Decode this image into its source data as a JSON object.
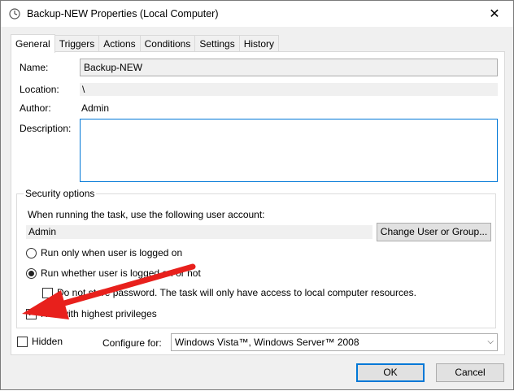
{
  "window": {
    "title": "Backup-NEW Properties (Local Computer)",
    "close_label": "✕"
  },
  "tabs": [
    {
      "label": "General",
      "active": true
    },
    {
      "label": "Triggers"
    },
    {
      "label": "Actions"
    },
    {
      "label": "Conditions"
    },
    {
      "label": "Settings"
    },
    {
      "label": "History"
    }
  ],
  "general": {
    "name_label": "Name:",
    "name_value": "Backup-NEW",
    "location_label": "Location:",
    "location_value": "\\",
    "author_label": "Author:",
    "author_value": "Admin",
    "description_label": "Description:",
    "description_value": ""
  },
  "security": {
    "group_title": "Security options",
    "account_prompt": "When running the task, use the following user account:",
    "account_value": "Admin",
    "change_user_button": "Change User or Group...",
    "radio_logged_on": "Run only when user is logged on",
    "radio_logged_on_checked": false,
    "radio_whether": "Run whether user is logged on or not",
    "radio_whether_checked": true,
    "no_store_password": "Do not store password.  The task will only have access to local computer resources.",
    "no_store_password_checked": false,
    "highest_privileges": "Run with highest privileges",
    "highest_privileges_checked": true
  },
  "bottom": {
    "hidden_label": "Hidden",
    "hidden_checked": false,
    "configure_label": "Configure for:",
    "configure_value": "Windows Vista™, Windows Server™ 2008"
  },
  "buttons": {
    "ok": "OK",
    "cancel": "Cancel"
  },
  "annotation": {
    "arrow_color": "#e8201c"
  }
}
